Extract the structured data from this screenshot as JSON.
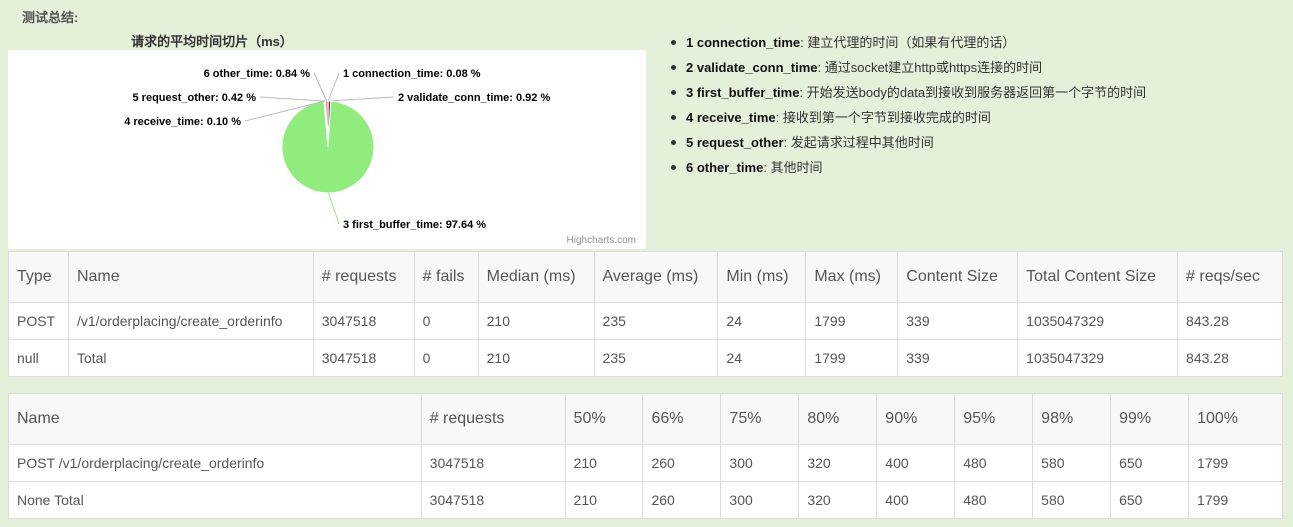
{
  "summary": {
    "title": "测试总结:"
  },
  "chart_data": {
    "type": "pie",
    "title": "请求的平均时间切片（ms）",
    "credits": "Highcharts.com",
    "slices": [
      {
        "name": "1 connection_time",
        "value": 0.08,
        "label": "1 connection_time: 0.08 %",
        "color": "#7cb5ec"
      },
      {
        "name": "2 validate_conn_time",
        "value": 0.92,
        "label": "2 validate_conn_time: 0.92 %",
        "color": "#434348"
      },
      {
        "name": "3 first_buffer_time",
        "value": 97.64,
        "label": "3 first_buffer_time: 97.64 %",
        "color": "#90ed7d"
      },
      {
        "name": "4 receive_time",
        "value": 0.1,
        "label": "4 receive_time: 0.10 %",
        "color": "#f7a35c"
      },
      {
        "name": "5 request_other",
        "value": 0.42,
        "label": "5 request_other: 0.42 %",
        "color": "#8085e9"
      },
      {
        "name": "6 other_time",
        "value": 0.84,
        "label": "6 other_time: 0.84 %",
        "color": "#f15c80"
      }
    ]
  },
  "legend": [
    {
      "key": "1 connection_time",
      "desc": ": 建立代理的时间（如果有代理的话）"
    },
    {
      "key": "2 validate_conn_time",
      "desc": ": 通过socket建立http或https连接的时间"
    },
    {
      "key": "3 first_buffer_time",
      "desc": ": 开始发送body的data到接收到服务器返回第一个字节的时间"
    },
    {
      "key": "4 receive_time",
      "desc": ": 接收到第一个字节到接收完成的时间"
    },
    {
      "key": "5 request_other",
      "desc": ": 发起请求过程中其他时间"
    },
    {
      "key": "6 other_time",
      "desc": ": 其他时间"
    }
  ],
  "stats_table": {
    "headers": [
      "Type",
      "Name",
      "# requests",
      "# fails",
      "Median (ms)",
      "Average (ms)",
      "Min (ms)",
      "Max (ms)",
      "Content Size",
      "Total Content Size",
      "# reqs/sec"
    ],
    "rows": [
      [
        "POST",
        "/v1/orderplacing/create_orderinfo",
        "3047518",
        "0",
        "210",
        "235",
        "24",
        "1799",
        "339",
        "1035047329",
        "843.28"
      ],
      [
        "null",
        "Total",
        "3047518",
        "0",
        "210",
        "235",
        "24",
        "1799",
        "339",
        "1035047329",
        "843.28"
      ]
    ]
  },
  "percentile_table": {
    "headers": [
      "Name",
      "# requests",
      "50%",
      "66%",
      "75%",
      "80%",
      "90%",
      "95%",
      "98%",
      "99%",
      "100%"
    ],
    "rows": [
      [
        "POST /v1/orderplacing/create_orderinfo",
        "3047518",
        "210",
        "260",
        "300",
        "320",
        "400",
        "480",
        "580",
        "650",
        "1799"
      ],
      [
        "None Total",
        "3047518",
        "210",
        "260",
        "300",
        "320",
        "400",
        "480",
        "580",
        "650",
        "1799"
      ]
    ]
  }
}
